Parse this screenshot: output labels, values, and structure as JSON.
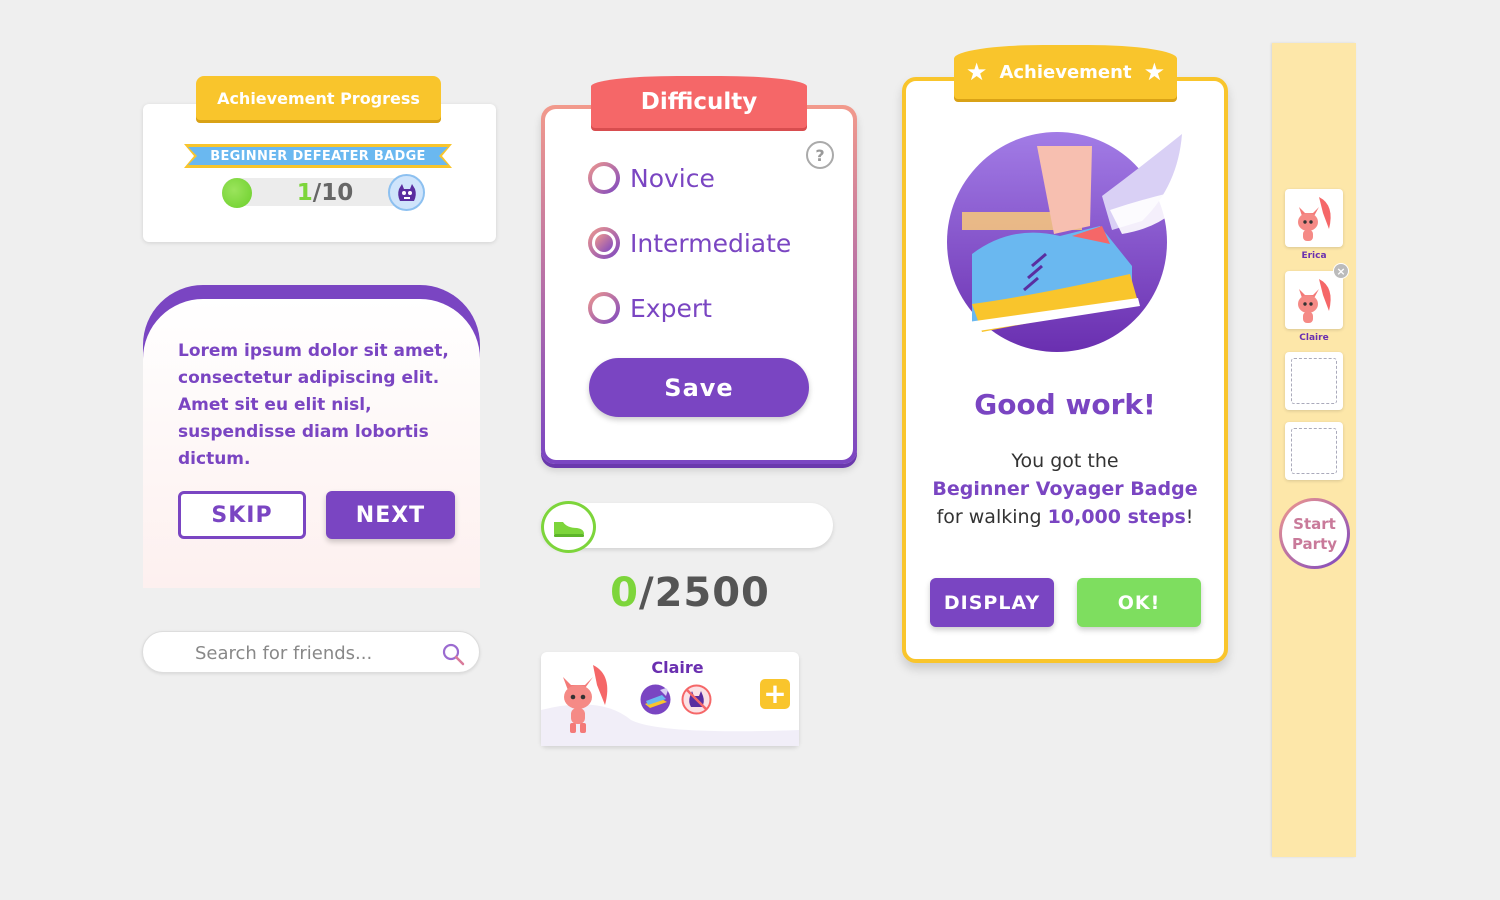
{
  "achievement_progress": {
    "title": "Achievement Progress",
    "badge_name": "BEGINNER DEFEATER BADGE",
    "current": "1",
    "total": "/10",
    "progress_fraction": 0.1
  },
  "tutorial": {
    "text": "Lorem ipsum dolor sit amet, consectetur adipiscing elit. Amet sit eu elit nisl, suspendisse diam lobortis dictum.",
    "skip_label": "SKIP",
    "next_label": "NEXT"
  },
  "search": {
    "placeholder": "Search for friends..."
  },
  "difficulty": {
    "title": "Difficulty",
    "help": "?",
    "options": [
      {
        "label": "Novice",
        "selected": false
      },
      {
        "label": "Intermediate",
        "selected": true
      },
      {
        "label": "Expert",
        "selected": false
      }
    ],
    "save_label": "Save"
  },
  "steps": {
    "current": "0",
    "total": "/2500",
    "progress_fraction": 0
  },
  "friend": {
    "name": "Claire",
    "add": "+"
  },
  "achievement": {
    "tab_label": "Achievement",
    "heading": "Good work!",
    "line1": "You got the",
    "badge": "Beginner Voyager Badge",
    "line3_prefix": "for walking ",
    "steps": "10,000 steps",
    "line3_suffix": "!",
    "display_label": "DISPLAY",
    "ok_label": "OK!"
  },
  "party": {
    "members": [
      "Erica",
      "Claire"
    ],
    "remove": "×",
    "start_label_1": "Start",
    "start_label_2": "Party"
  },
  "colors": {
    "purple": "#7a45c2",
    "yellow": "#f9c52c",
    "green": "#7dd53b",
    "coral": "#f56768",
    "party_bg": "#fde7a9"
  }
}
